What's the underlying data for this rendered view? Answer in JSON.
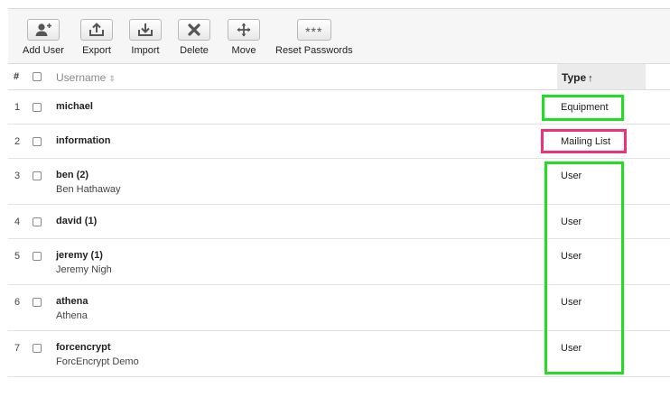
{
  "toolbar": {
    "add_user": {
      "label": "Add User",
      "icon": "add-user-icon"
    },
    "export": {
      "label": "Export",
      "icon": "export-icon"
    },
    "import": {
      "label": "Import",
      "icon": "import-icon"
    },
    "delete": {
      "label": "Delete",
      "icon": "delete-icon"
    },
    "move": {
      "label": "Move",
      "icon": "move-icon"
    },
    "reset": {
      "label": "Reset Passwords",
      "icon": "reset-passwords-icon",
      "glyph": "***"
    }
  },
  "table": {
    "headers": {
      "num": "#",
      "username": "Username",
      "type": "Type"
    },
    "sort": {
      "column": "type",
      "direction": "ascending"
    },
    "rows": [
      {
        "num": "1",
        "name": "michael",
        "fullname": "",
        "type": "Equipment"
      },
      {
        "num": "2",
        "name": "information",
        "fullname": "",
        "type": "Mailing List"
      },
      {
        "num": "3",
        "name": "ben (2)",
        "fullname": "Ben Hathaway",
        "type": "User"
      },
      {
        "num": "4",
        "name": "david (1)",
        "fullname": "",
        "type": "User"
      },
      {
        "num": "5",
        "name": "jeremy (1)",
        "fullname": "Jeremy Nigh",
        "type": "User"
      },
      {
        "num": "6",
        "name": "athena",
        "fullname": "Athena",
        "type": "User"
      },
      {
        "num": "7",
        "name": "forcencrypt",
        "fullname": "ForcEncrypt Demo",
        "type": "User"
      }
    ]
  },
  "highlight_colors": {
    "equipment": "#1ee01e",
    "mailing_list": "#f0307a",
    "users": "#1ee01e"
  }
}
